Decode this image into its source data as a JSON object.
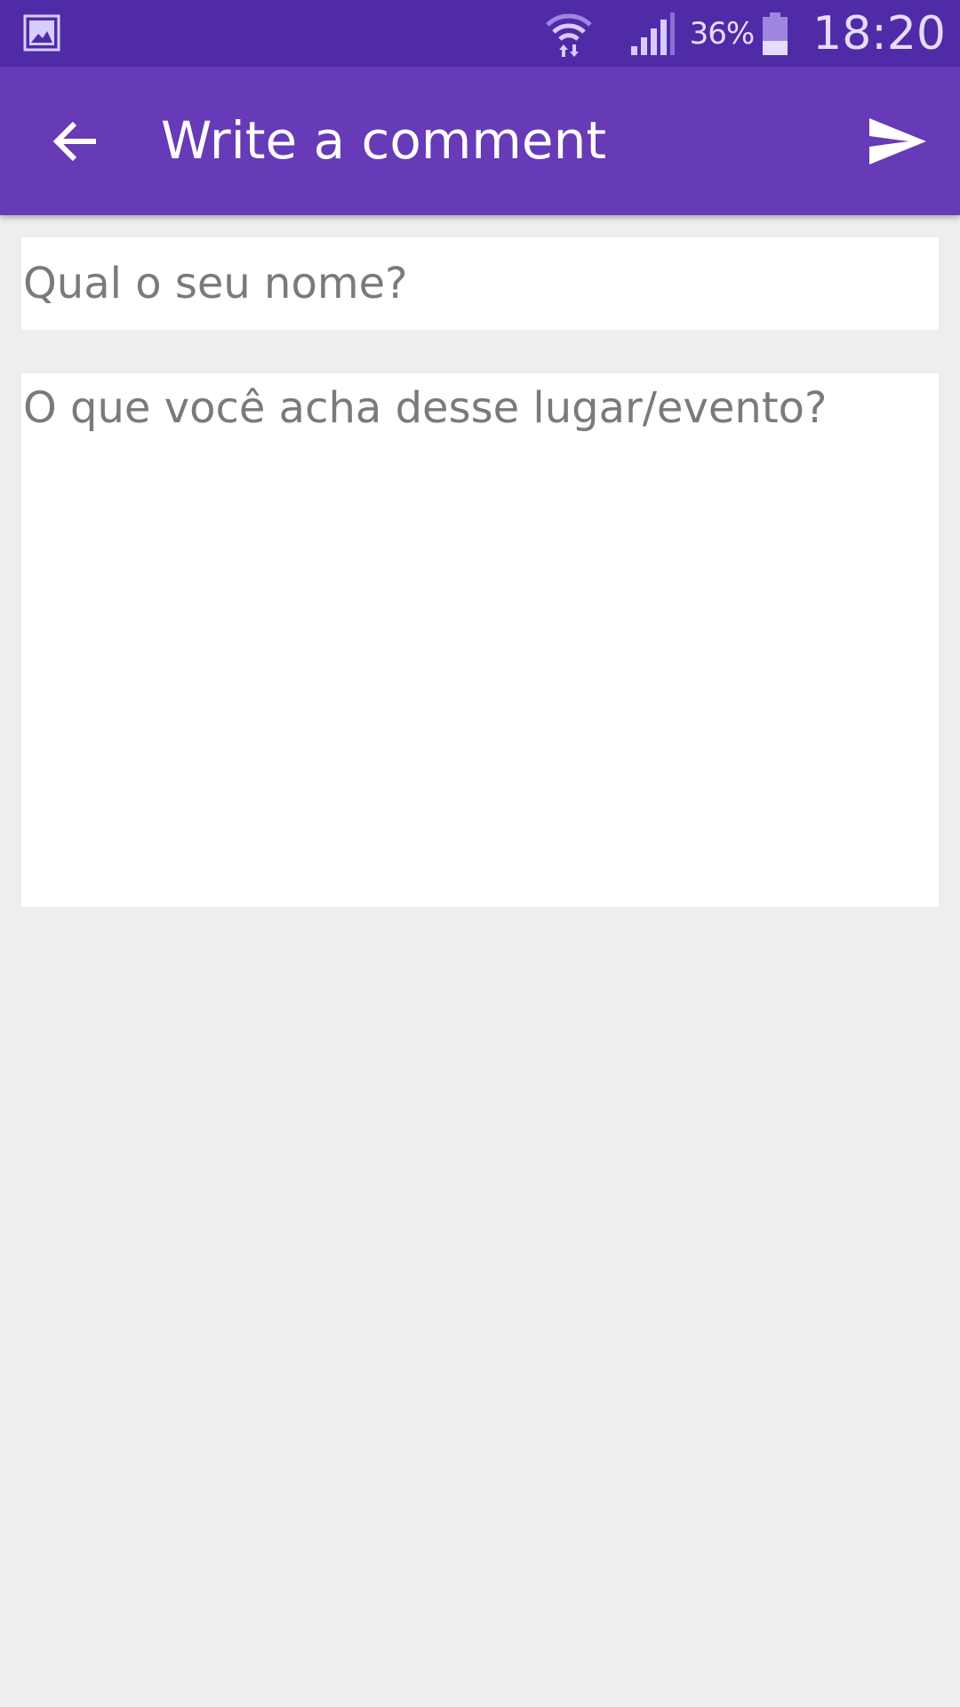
{
  "status_bar": {
    "notification_icon": "image-icon",
    "wifi_icon": "wifi-data-transfer-icon",
    "signal_icon": "cell-signal-icon",
    "battery_percent": "36%",
    "battery_icon": "battery-icon",
    "battery_level": 0.36,
    "time": "18:20"
  },
  "app_bar": {
    "back_icon": "arrow-back-icon",
    "title": "Write a comment",
    "send_icon": "send-icon"
  },
  "form": {
    "name": {
      "value": "",
      "placeholder": "Qual o seu nome?"
    },
    "comment": {
      "value": "",
      "placeholder": "O que você acha desse lugar/evento?"
    }
  },
  "colors": {
    "status_bar": "#4f2ba8",
    "app_bar": "#673ab7",
    "background": "#eeeeee",
    "field_background": "#ffffff",
    "placeholder_text": "#7a7a7a"
  }
}
